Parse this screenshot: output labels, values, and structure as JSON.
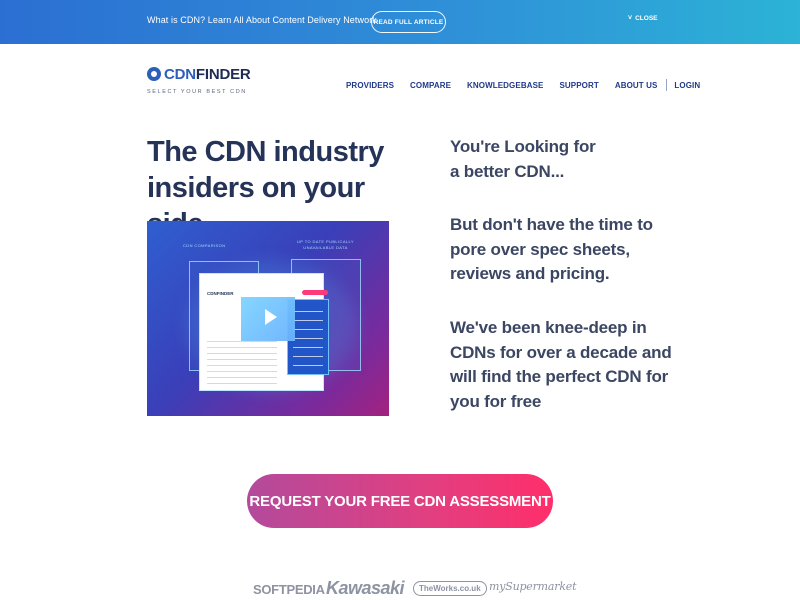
{
  "banner": {
    "text": "What is CDN? Learn All About Content Delivery Network",
    "button_label": "READ FULL ARTICLE",
    "close_label": "CLOSE",
    "close_icon": "chevron-down-icon"
  },
  "logo": {
    "prefix": "CDN",
    "suffix": "FINDER",
    "tagline": "SELECT YOUR BEST CDN"
  },
  "nav": {
    "items": [
      "PROVIDERS",
      "COMPARE",
      "KNOWLEDGEBASE",
      "SUPPORT",
      "ABOUT US"
    ],
    "login": "LOGIN"
  },
  "hero": {
    "title_line1": "The CDN industry",
    "title_line2": "insiders on your side",
    "image": {
      "label_left": "CDN COMPARISON",
      "label_right_line1": "UP TO DATE PUBLICALLY",
      "label_right_line2": "UNAVAILABLE DATA",
      "mini_logo": "CDNFINDER"
    },
    "right": {
      "p1_line1": "You're Looking for",
      "p1_line2": "a better CDN...",
      "p2_line1": "But don't have the time to",
      "p2_line2": "pore over spec sheets,",
      "p2_line3": "reviews and pricing.",
      "p3_line1": "We've been knee-deep in",
      "p3_line2": "CDNs for over a decade and",
      "p3_line3": "will find the perfect CDN for",
      "p3_line4": "you for free"
    }
  },
  "cta": {
    "label": "REQUEST YOUR FREE CDN ASSESSMENT"
  },
  "clients": [
    "SOFTPEDIA",
    "Kawasaki",
    "TheWorks.co.uk",
    "mySupermarket"
  ],
  "colors": {
    "banner_start": "#2b6fd2",
    "banner_end": "#2cb3d6",
    "nav": "#1f3a8a",
    "heading": "#243357",
    "cta_start": "#b34a9b",
    "cta_end": "#ff2e6a"
  }
}
